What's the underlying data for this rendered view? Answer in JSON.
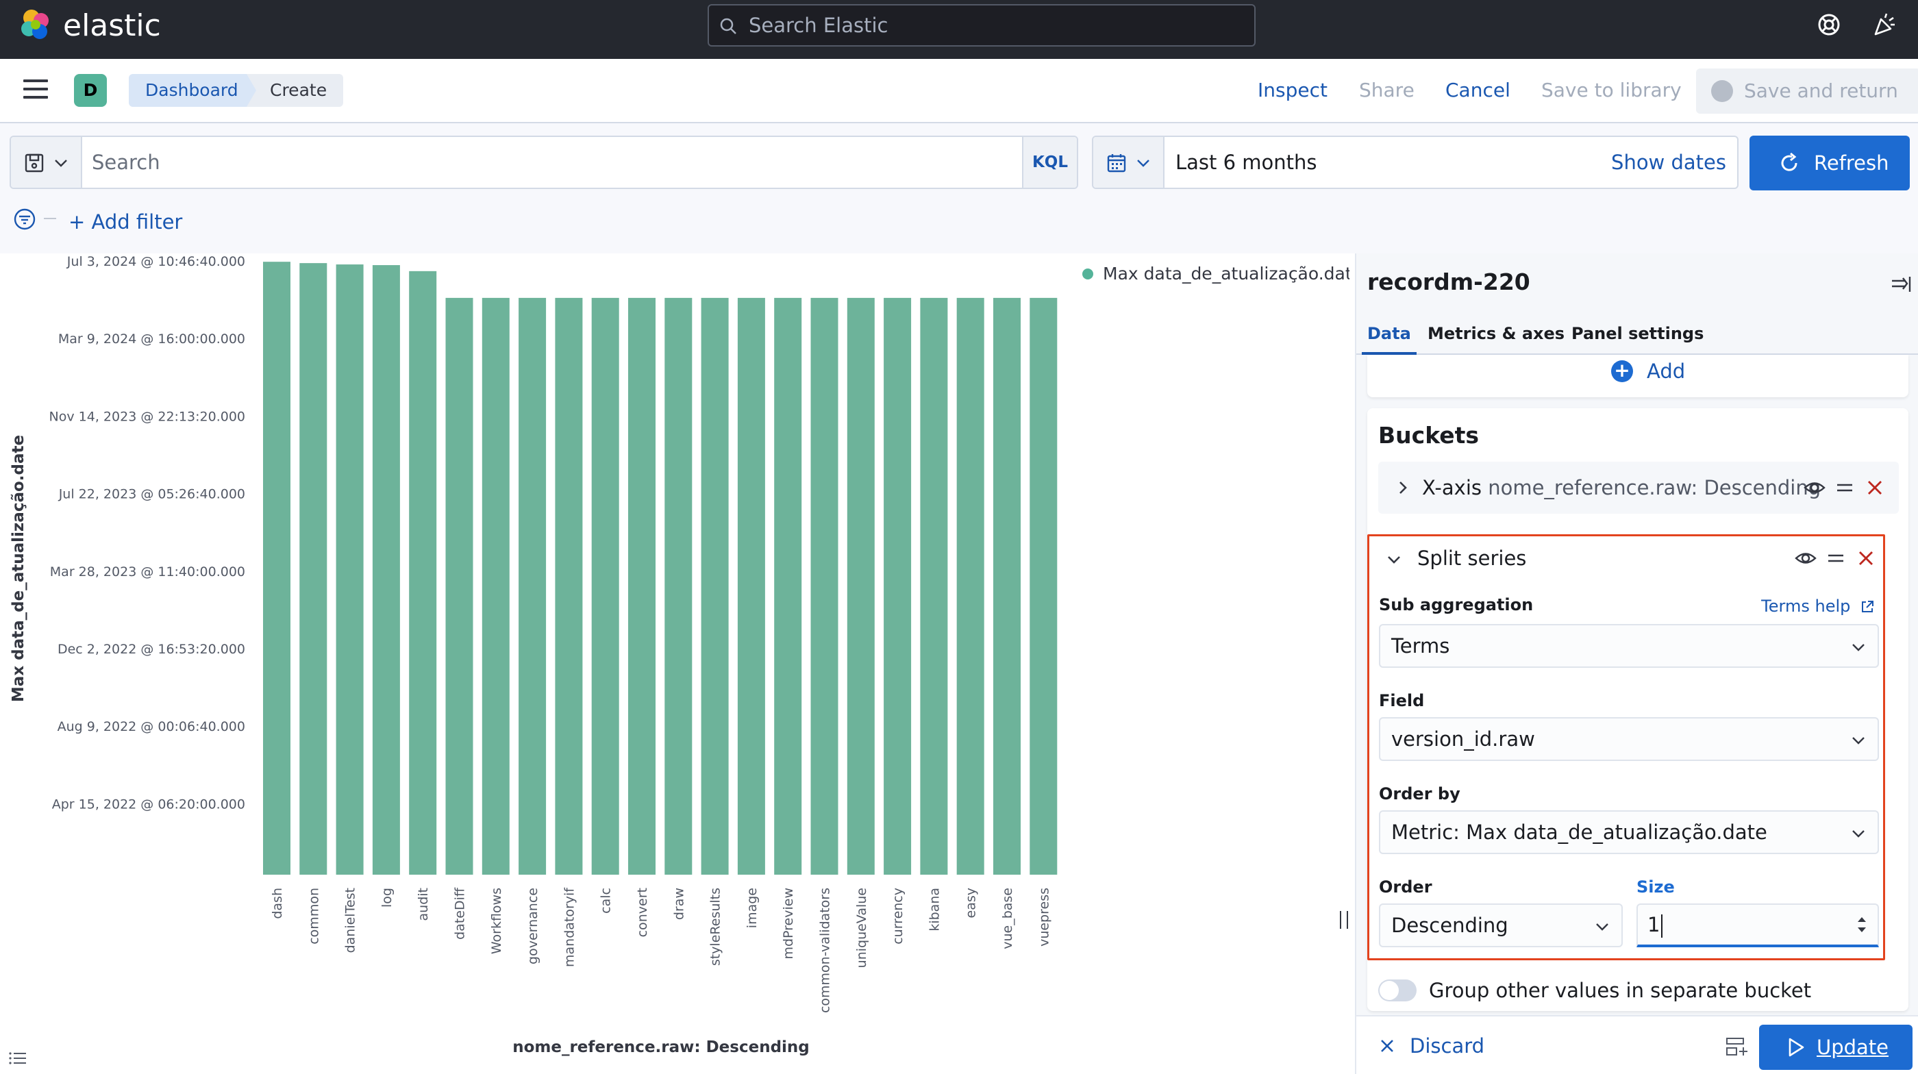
{
  "header": {
    "logo_text": "elastic",
    "search_placeholder": "Search Elastic"
  },
  "app_bar": {
    "avatar_letter": "D",
    "breadcrumbs": [
      "Dashboard",
      "Create"
    ],
    "buttons": {
      "inspect": "Inspect",
      "share": "Share",
      "cancel": "Cancel",
      "save_to_library": "Save to library",
      "save_and_return": "Save and return"
    }
  },
  "query_bar": {
    "search_placeholder": "Search",
    "language": "KQL",
    "time_range": "Last 6 months",
    "show_dates": "Show dates",
    "refresh": "Refresh",
    "add_filter": "+ Add filter"
  },
  "chart_data": {
    "type": "bar",
    "xlabel": "nome_reference.raw: Descending",
    "ylabel": "Max data_de_atualização.date",
    "legend": [
      "Max data_de_atualização.date"
    ],
    "legend_position": "top-right",
    "color": "#6db39a",
    "y_tick_labels": [
      "Jul 3, 2024 @ 10:46:40.000",
      "Mar 9, 2024 @ 16:00:00.000",
      "Nov 14, 2023 @ 22:13:20.000",
      "Jul 22, 2023 @ 05:26:40.000",
      "Mar 28, 2023 @ 11:40:00.000",
      "Dec 2, 2022 @ 16:53:20.000",
      "Aug 9, 2022 @ 00:06:40.000",
      "Apr 15, 2022 @ 06:20:00.000"
    ],
    "categories": [
      "dash",
      "common",
      "danielTest",
      "log",
      "audit",
      "dateDiff",
      "Workflows",
      "governance",
      "mandatoryif",
      "calc",
      "convert",
      "draw",
      "styleResults",
      "image",
      "mdPreview",
      "common-validators",
      "uniqueValue",
      "currency",
      "kibana",
      "easy",
      "vue_base",
      "vuepress"
    ],
    "values": [
      "2024-07-03",
      "2024-07-01",
      "2024-06-29",
      "2024-06-28",
      "2024-06-19",
      "2024-05-10",
      "2024-05-10",
      "2024-05-10",
      "2024-05-10",
      "2024-05-10",
      "2024-05-10",
      "2024-05-10",
      "2024-05-10",
      "2024-05-10",
      "2024-05-10",
      "2024-05-10",
      "2024-05-10",
      "2024-05-10",
      "2024-05-10",
      "2024-05-10",
      "2024-05-10",
      "2024-05-10"
    ]
  },
  "panel": {
    "title": "recordm-220",
    "tabs": [
      "Data",
      "Metrics & axes",
      "Panel settings"
    ],
    "add_label": "Add",
    "buckets_title": "Buckets",
    "xaxis_label": "X-axis",
    "xaxis_sub": "nome_reference.raw: Descending",
    "split_title": "Split series",
    "sub_aggregation_label": "Sub aggregation",
    "terms_help": "Terms help",
    "sub_aggregation_value": "Terms",
    "field_label": "Field",
    "field_value": "version_id.raw",
    "order_by_label": "Order by",
    "order_by_value": "Metric: Max data_de_atualização.date",
    "order_label": "Order",
    "order_value": "Descending",
    "size_label": "Size",
    "size_value": "1",
    "group_other_label": "Group other values in separate bucket",
    "discard": "Discard",
    "update": "Update"
  }
}
